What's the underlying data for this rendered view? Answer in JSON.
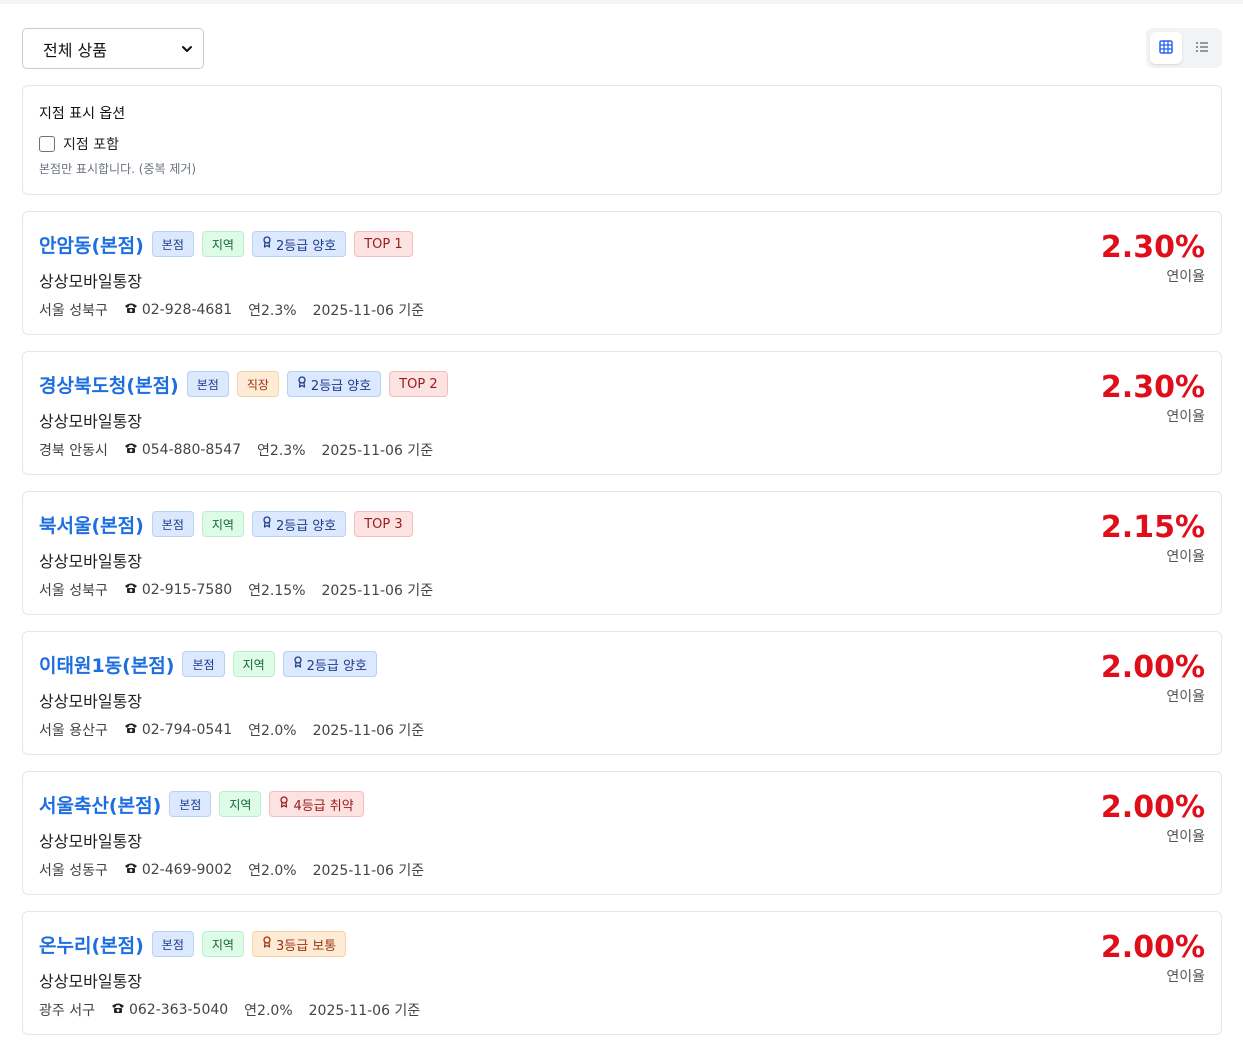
{
  "filter": {
    "selected": "전체 상품"
  },
  "view_toggle": {
    "active": "grid",
    "grid_icon": "grid-icon",
    "list_icon": "list-icon"
  },
  "options": {
    "title": "지점 표시 옵션",
    "checkbox_label": "지점 포함",
    "checkbox_checked": false,
    "hint": "본점만 표시합니다. (중복 제거)"
  },
  "rate_label": "연이율",
  "cards": [
    {
      "name": "안암동(본점)",
      "badges": [
        "본점",
        "지역"
      ],
      "badge_styles": [
        "blue",
        "green"
      ],
      "grade": "2등급 양호",
      "grade_style": "grade-good",
      "top": "TOP 1",
      "product": "상상모바일통장",
      "region": "서울 성북구",
      "phone": "02-928-4681",
      "annual": "연2.3%",
      "date": "2025-11-06 기준",
      "rate": "2.30%"
    },
    {
      "name": "경상북도청(본점)",
      "badges": [
        "본점",
        "직장"
      ],
      "badge_styles": [
        "blue",
        "orange"
      ],
      "grade": "2등급 양호",
      "grade_style": "grade-good",
      "top": "TOP 2",
      "product": "상상모바일통장",
      "region": "경북 안동시",
      "phone": "054-880-8547",
      "annual": "연2.3%",
      "date": "2025-11-06 기준",
      "rate": "2.30%"
    },
    {
      "name": "북서울(본점)",
      "badges": [
        "본점",
        "지역"
      ],
      "badge_styles": [
        "blue",
        "green"
      ],
      "grade": "2등급 양호",
      "grade_style": "grade-good",
      "top": "TOP 3",
      "product": "상상모바일통장",
      "region": "서울 성북구",
      "phone": "02-915-7580",
      "annual": "연2.15%",
      "date": "2025-11-06 기준",
      "rate": "2.15%"
    },
    {
      "name": "이태원1동(본점)",
      "badges": [
        "본점",
        "지역"
      ],
      "badge_styles": [
        "blue",
        "green"
      ],
      "grade": "2등급 양호",
      "grade_style": "grade-good",
      "top": "",
      "product": "상상모바일통장",
      "region": "서울 용산구",
      "phone": "02-794-0541",
      "annual": "연2.0%",
      "date": "2025-11-06 기준",
      "rate": "2.00%"
    },
    {
      "name": "서울축산(본점)",
      "badges": [
        "본점",
        "지역"
      ],
      "badge_styles": [
        "blue",
        "green"
      ],
      "grade": "4등급 취약",
      "grade_style": "grade-weak",
      "top": "",
      "product": "상상모바일통장",
      "region": "서울 성동구",
      "phone": "02-469-9002",
      "annual": "연2.0%",
      "date": "2025-11-06 기준",
      "rate": "2.00%"
    },
    {
      "name": "온누리(본점)",
      "badges": [
        "본점",
        "지역"
      ],
      "badge_styles": [
        "blue",
        "green"
      ],
      "grade": "3등급 보통",
      "grade_style": "grade-mid",
      "top": "",
      "product": "상상모바일통장",
      "region": "광주 서구",
      "phone": "062-363-5040",
      "annual": "연2.0%",
      "date": "2025-11-06 기준",
      "rate": "2.00%"
    }
  ],
  "colors": {
    "name": "#1d6fe0",
    "rate": "#e00d1a"
  }
}
